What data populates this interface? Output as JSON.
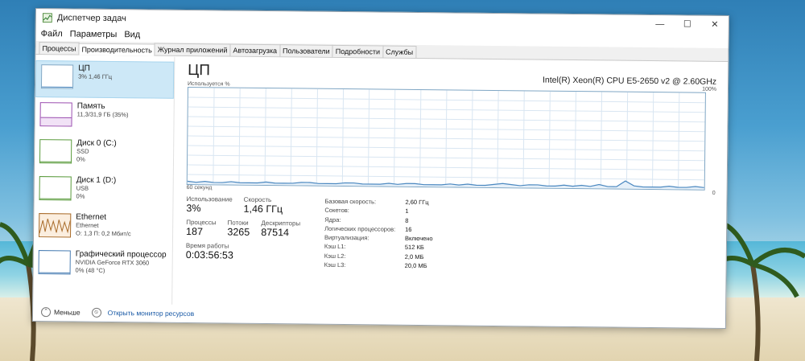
{
  "window": {
    "title": "Диспетчер задач",
    "controls": {
      "minimize": "—",
      "maximize": "☐",
      "close": "✕"
    }
  },
  "menu": [
    "Файл",
    "Параметры",
    "Вид"
  ],
  "tabs": [
    "Процессы",
    "Производительность",
    "Журнал приложений",
    "Автозагрузка",
    "Пользователи",
    "Подробности",
    "Службы"
  ],
  "active_tab": 1,
  "sidebar": [
    {
      "title": "ЦП",
      "sub1": "3% 1,46 ГГц",
      "sub2": "",
      "icon": "cpu-graph-icon"
    },
    {
      "title": "Память",
      "sub1": "11,3/31,9 ГБ (35%)",
      "sub2": "",
      "icon": "memory-graph-icon"
    },
    {
      "title": "Диск 0 (C:)",
      "sub1": "SSD",
      "sub2": "0%",
      "icon": "disk-graph-icon"
    },
    {
      "title": "Диск 1 (D:)",
      "sub1": "USB",
      "sub2": "0%",
      "icon": "disk-graph-icon"
    },
    {
      "title": "Ethernet",
      "sub1": "Ethernet",
      "sub2": "О: 1,3 П: 0,2 Мбит/с",
      "icon": "network-graph-icon"
    },
    {
      "title": "Графический процессор",
      "sub1": "NVIDIA GeForce RTX 3060",
      "sub2": "0% (48 °C)",
      "icon": "gpu-graph-icon"
    }
  ],
  "main": {
    "title": "ЦП",
    "cpu_model": "Intel(R) Xeon(R) CPU E5-2650 v2 @ 2.60GHz",
    "graph_label": "Используется %",
    "graph_max": "100%",
    "graph_time": "60 секунд",
    "graph_min": "0"
  },
  "stats": {
    "usage_label": "Использование",
    "usage_value": "3%",
    "speed_label": "Скорость",
    "speed_value": "1,46 ГГц",
    "processes_label": "Процессы",
    "processes_value": "187",
    "threads_label": "Потоки",
    "threads_value": "3265",
    "handles_label": "Дескрипторы",
    "handles_value": "87514",
    "uptime_label": "Время работы",
    "uptime_value": "0:03:56:53"
  },
  "specs": [
    {
      "k": "Базовая скорость:",
      "v": "2,60 ГГц"
    },
    {
      "k": "Сокетов:",
      "v": "1"
    },
    {
      "k": "Ядра:",
      "v": "8"
    },
    {
      "k": "Логических процессоров:",
      "v": "16"
    },
    {
      "k": "Виртуализация:",
      "v": "Включено"
    },
    {
      "k": "Кэш L1:",
      "v": "512 КБ"
    },
    {
      "k": "Кэш L2:",
      "v": "2,0 МБ"
    },
    {
      "k": "Кэш L3:",
      "v": "20,0 МБ"
    }
  ],
  "footer": {
    "fewer": "Меньше",
    "monitor_link": "Открыть монитор ресурсов"
  },
  "cpu_history_percent": [
    3,
    2,
    3,
    2,
    2,
    3,
    2,
    2,
    2,
    3,
    2,
    2,
    2,
    3,
    3,
    2,
    2,
    2,
    3,
    3,
    2,
    2,
    2,
    3,
    2,
    3,
    3,
    2,
    2,
    2,
    3,
    2,
    3,
    2,
    2,
    3,
    4,
    3,
    2,
    3,
    3,
    2,
    2,
    3,
    2,
    3,
    2,
    4,
    2,
    2,
    8,
    3,
    2,
    2,
    2,
    3,
    2,
    2,
    3,
    2
  ]
}
